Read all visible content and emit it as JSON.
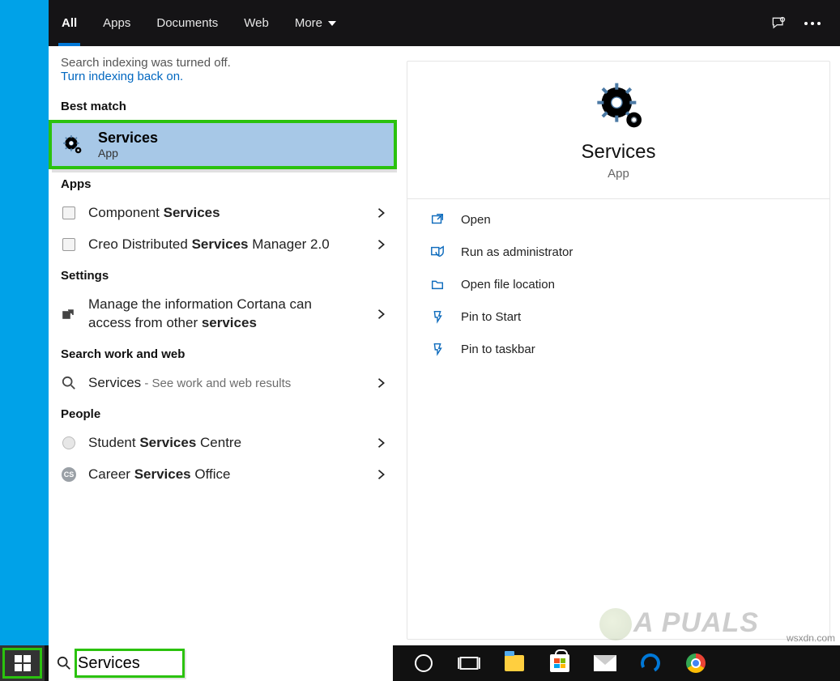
{
  "tabs": {
    "all": "All",
    "apps": "Apps",
    "documents": "Documents",
    "web": "Web",
    "more": "More"
  },
  "indexing": {
    "off_msg": "Search indexing was turned off.",
    "link": "Turn indexing back on."
  },
  "sections": {
    "best_match": "Best match",
    "apps": "Apps",
    "settings": "Settings",
    "search_ww": "Search work and web",
    "people": "People"
  },
  "best_match": {
    "title": "Services",
    "subtitle": "App"
  },
  "apps_results": [
    {
      "pre": "Component ",
      "bold": "Services",
      "post": ""
    },
    {
      "pre": "Creo Distributed ",
      "bold": "Services",
      "post": " Manager 2.0"
    }
  ],
  "settings_results": [
    {
      "pre": "Manage the information Cortana can access from other ",
      "bold": "services",
      "post": ""
    }
  ],
  "ww_results": [
    {
      "pre": "",
      "bold": "Services",
      "post": "",
      "note": " - See work and web results"
    }
  ],
  "people_results": [
    {
      "pre": "Student ",
      "bold": "Services",
      "post": " Centre"
    },
    {
      "pre": "Career ",
      "bold": "Services",
      "post": " Office",
      "badge": "CS"
    }
  ],
  "preview": {
    "title": "Services",
    "subtitle": "App",
    "actions": {
      "open": "Open",
      "admin": "Run as administrator",
      "location": "Open file location",
      "pin_start": "Pin to Start",
      "pin_taskbar": "Pin to taskbar"
    }
  },
  "taskbar": {
    "search_value": "Services"
  },
  "watermark": "wsxdn.com",
  "appuals": "A  PUALS"
}
